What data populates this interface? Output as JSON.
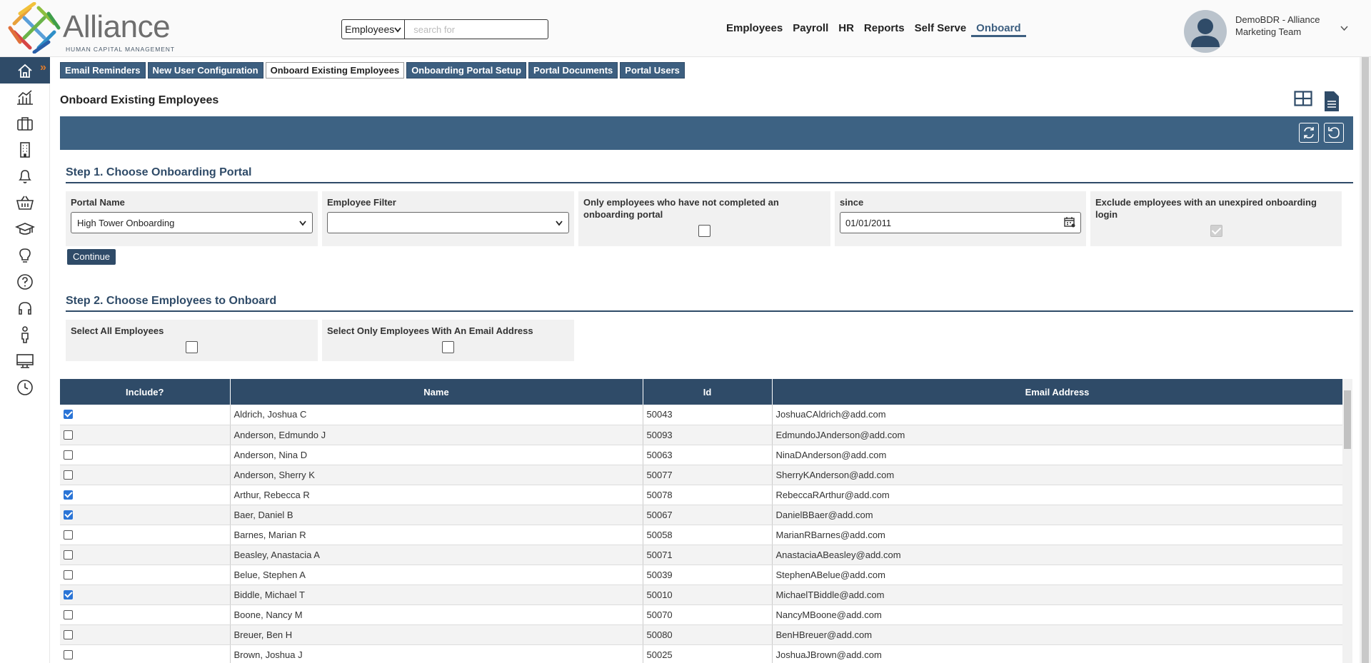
{
  "brand": {
    "name": "Alliance",
    "tagline": "HUMAN CAPITAL MANAGEMENT"
  },
  "search": {
    "scope": "Employees",
    "placeholder": "search for"
  },
  "topnav": [
    {
      "label": "Employees"
    },
    {
      "label": "Payroll"
    },
    {
      "label": "HR"
    },
    {
      "label": "Reports"
    },
    {
      "label": "Self Serve"
    },
    {
      "label": "Onboard"
    }
  ],
  "user": {
    "name_line1": "DemoBDR - Alliance",
    "name_line2": "Marketing Team"
  },
  "subtabs": [
    {
      "label": "Email Reminders"
    },
    {
      "label": "New User Configuration"
    },
    {
      "label": "Onboard Existing Employees"
    },
    {
      "label": "Onboarding Portal Setup"
    },
    {
      "label": "Portal Documents"
    },
    {
      "label": "Portal Users"
    }
  ],
  "page": {
    "title": "Onboard Existing Employees"
  },
  "step1": {
    "heading": "Step 1. Choose Onboarding Portal",
    "portal_label": "Portal Name",
    "portal_value": "High Tower Onboarding",
    "filter_label": "Employee Filter",
    "filter_value": "",
    "only_label": "Only employees who have not completed an onboarding portal",
    "since_label": "since",
    "since_value": "01/01/2011",
    "exclude_label": "Exclude employees with an unexpired onboarding login",
    "continue_label": "Continue"
  },
  "step2": {
    "heading": "Step 2. Choose Employees to Onboard",
    "select_all_label": "Select All Employees",
    "select_email_label": "Select Only Employees With An Email Address"
  },
  "table": {
    "headers": [
      "Include?",
      "Name",
      "Id",
      "Email Address"
    ],
    "rows": [
      {
        "checked": true,
        "name": "Aldrich, Joshua C",
        "id": "50043",
        "email": "JoshuaCAldrich@add.com"
      },
      {
        "checked": false,
        "name": "Anderson, Edmundo J",
        "id": "50093",
        "email": "EdmundoJAnderson@add.com"
      },
      {
        "checked": false,
        "name": "Anderson, Nina D",
        "id": "50063",
        "email": "NinaDAnderson@add.com"
      },
      {
        "checked": false,
        "name": "Anderson, Sherry K",
        "id": "50077",
        "email": "SherryKAnderson@add.com"
      },
      {
        "checked": true,
        "name": "Arthur, Rebecca R",
        "id": "50078",
        "email": "RebeccaRArthur@add.com"
      },
      {
        "checked": true,
        "name": "Baer, Daniel B",
        "id": "50067",
        "email": "DanielBBaer@add.com"
      },
      {
        "checked": false,
        "name": "Barnes, Marian R",
        "id": "50058",
        "email": "MarianRBarnes@add.com"
      },
      {
        "checked": false,
        "name": "Beasley, Anastacia A",
        "id": "50071",
        "email": "AnastaciaABeasley@add.com"
      },
      {
        "checked": false,
        "name": "Belue, Stephen A",
        "id": "50039",
        "email": "StephenABelue@add.com"
      },
      {
        "checked": true,
        "name": "Biddle, Michael T",
        "id": "50010",
        "email": "MichaelTBiddle@add.com"
      },
      {
        "checked": false,
        "name": "Boone, Nancy M",
        "id": "50070",
        "email": "NancyMBoone@add.com"
      },
      {
        "checked": false,
        "name": "Breuer, Ben H",
        "id": "50080",
        "email": "BenHBreuer@add.com"
      },
      {
        "checked": false,
        "name": "Brown, Joshua J",
        "id": "50025",
        "email": "JoshuaJBrown@add.com"
      }
    ]
  },
  "colors": {
    "primary": "#3d5f80",
    "dark": "#2f4b68",
    "accent": "#e07b2a"
  },
  "icons": {
    "sidebar": [
      "home-icon",
      "chart-icon",
      "briefcase-icon",
      "building-icon",
      "bell-icon",
      "basket-icon",
      "graduation-cap-icon",
      "lightbulb-icon",
      "help-icon",
      "headset-icon",
      "person-icon",
      "monitor-icon",
      "clock-icon"
    ]
  }
}
